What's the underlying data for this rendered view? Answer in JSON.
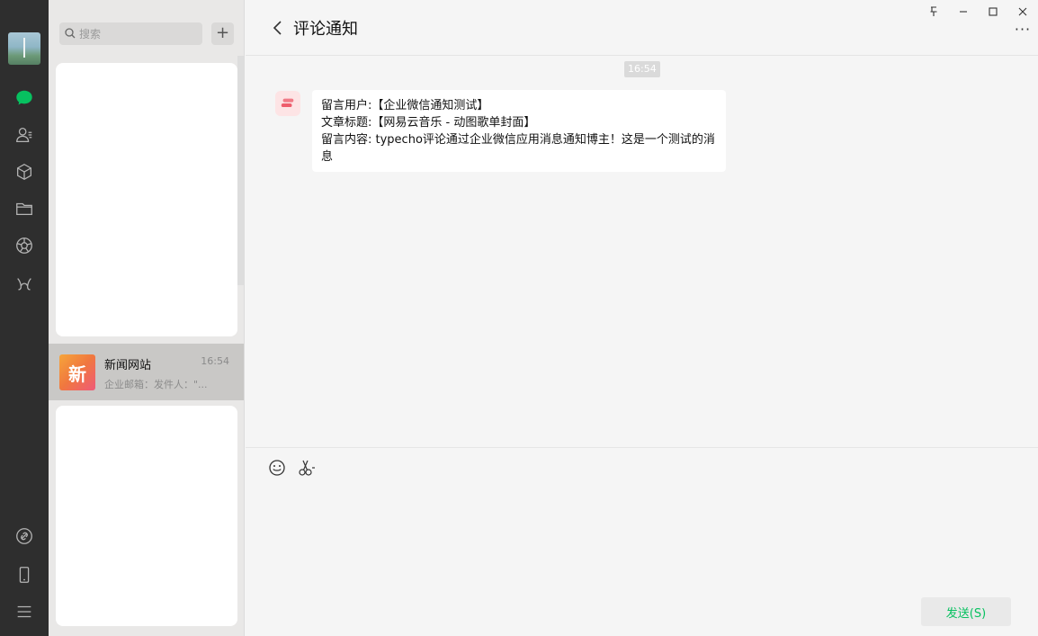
{
  "sidebar": {
    "user_avatar": "user-avatar",
    "icons": [
      "chat-icon",
      "contacts-icon",
      "cube-icon",
      "folder-icon",
      "aperture-icon",
      "mini-program-icon",
      "link-icon",
      "phone-icon",
      "menu-icon"
    ],
    "active_color": "#07c160"
  },
  "search": {
    "placeholder": "搜索",
    "add_label": "+"
  },
  "conversations": [
    {
      "name": "新闻网站",
      "time": "16:54",
      "preview": "企业邮箱：发件人：\"...",
      "avatar_text": "新"
    }
  ],
  "chat": {
    "title": "评论通知",
    "timestamp": "16:54",
    "message_lines": [
      "留言用户:【企业微信通知测试】",
      "文章标题:【网易云音乐 - 动图歌单封面】",
      "留言内容: typecho评论通过企业微信应用消息通知博主！这是一个测试的消息"
    ],
    "send_label": "发送(S)",
    "more_label": "···"
  },
  "colors": {
    "nav_bg": "#2e2e2e",
    "list_bg": "#e9e8e7",
    "chat_bg": "#f5f5f5",
    "accent": "#07c160"
  }
}
